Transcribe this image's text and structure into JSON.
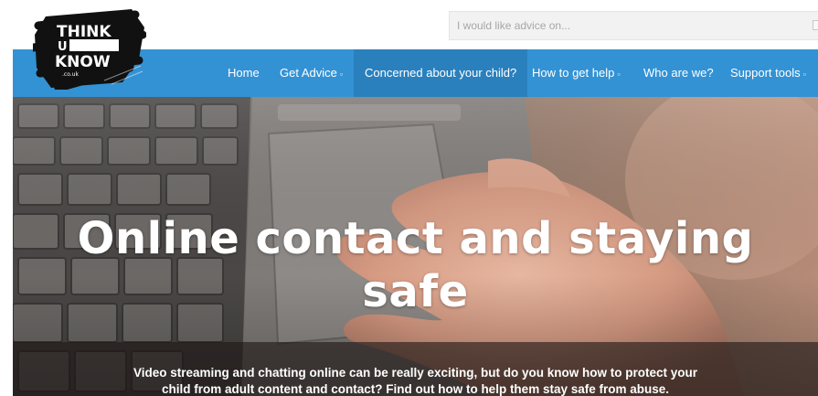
{
  "logo": {
    "line1": "THINK",
    "line2": "U",
    "line3": "KNOW",
    "domain": ".co.uk"
  },
  "search": {
    "placeholder": "I would like advice on..."
  },
  "nav": {
    "items": [
      {
        "label": "Home",
        "has_dropdown": false
      },
      {
        "label": "Get Advice",
        "has_dropdown": true
      },
      {
        "label": "Concerned about your child?",
        "has_dropdown": false,
        "active": true
      },
      {
        "label": "How to get help",
        "has_dropdown": true
      },
      {
        "label": "Who are we?",
        "has_dropdown": false
      },
      {
        "label": "Support tools",
        "has_dropdown": true
      }
    ],
    "caret": "▫",
    "color": "#3392d4",
    "active_color": "#2a80bd"
  },
  "hero": {
    "title_line1": "Online contact and staying",
    "title_line2": "safe",
    "caption_line1": "Video streaming and chatting online can be really exciting, but do you know how to protect your",
    "caption_line2": "child from adult content and contact? Find out how to help them stay safe from abuse."
  }
}
